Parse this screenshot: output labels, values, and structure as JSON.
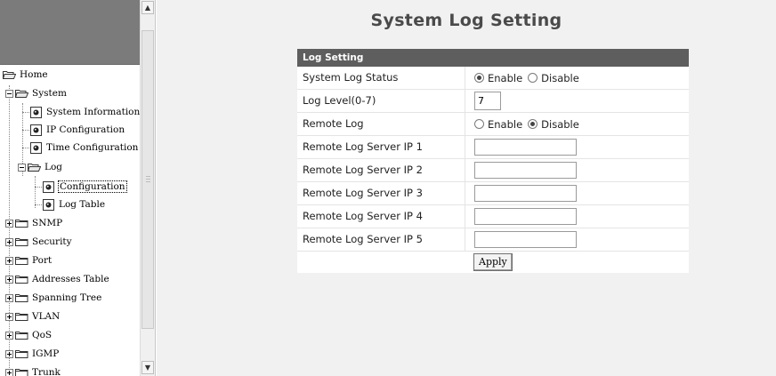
{
  "sidebar": {
    "tree": [
      {
        "label": "Home"
      },
      {
        "label": "System"
      },
      {
        "label": "System Information"
      },
      {
        "label": "IP Configuration"
      },
      {
        "label": "Time Configuration"
      },
      {
        "label": "Log"
      },
      {
        "label": "Configuration"
      },
      {
        "label": "Log Table"
      },
      {
        "label": "SNMP"
      },
      {
        "label": "Security"
      },
      {
        "label": "Port"
      },
      {
        "label": "Addresses Table"
      },
      {
        "label": "Spanning Tree"
      },
      {
        "label": "VLAN"
      },
      {
        "label": "QoS"
      },
      {
        "label": "IGMP"
      },
      {
        "label": "Trunk"
      }
    ]
  },
  "main": {
    "title": "System Log Setting",
    "section": "Log Setting",
    "rows": {
      "status_label": "System Log Status",
      "status_enable": "Enable",
      "status_disable": "Disable",
      "level_label": "Log Level(0-7)",
      "level_value": "7",
      "remote_label": "Remote Log",
      "remote_enable": "Enable",
      "remote_disable": "Disable",
      "server1_label": "Remote Log Server IP 1",
      "server2_label": "Remote Log Server IP 2",
      "server3_label": "Remote Log Server IP 3",
      "server4_label": "Remote Log Server IP 4",
      "server5_label": "Remote Log Server IP 5",
      "server1_value": "",
      "server2_value": "",
      "server3_value": "",
      "server4_value": "",
      "server5_value": ""
    },
    "apply_label": "Apply",
    "status_selected": "Enable",
    "remote_selected": "Disable"
  },
  "colors": {
    "section_header_bg": "#5e5e5e",
    "logo_bg": "#7b7b7b",
    "main_bg": "#f1f1f1",
    "title_color": "#4a4a4a"
  }
}
